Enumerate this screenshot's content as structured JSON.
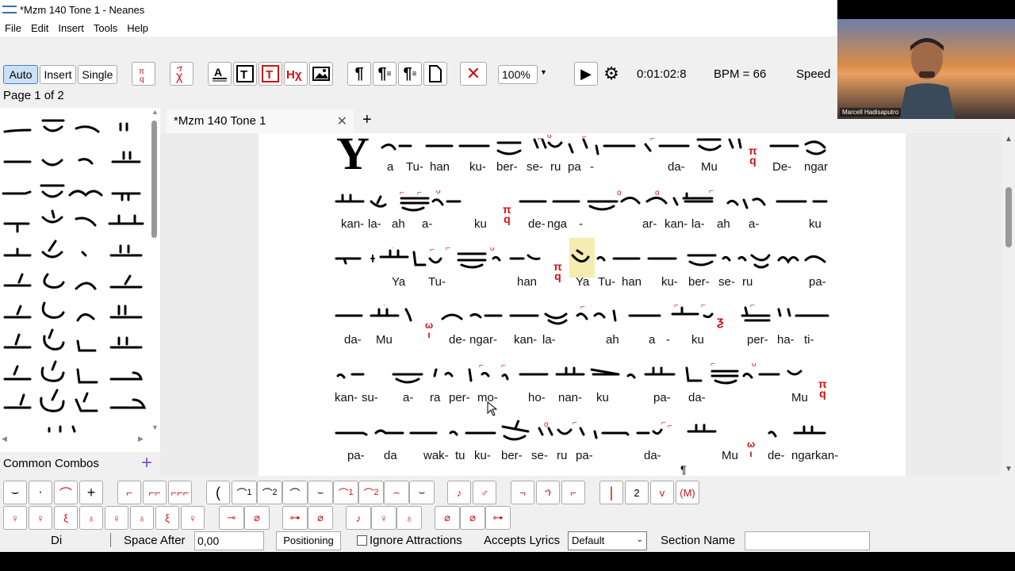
{
  "window": {
    "title": "*Mzm 140 Tone 1 - Neanes"
  },
  "menu": {
    "file": "File",
    "edit": "Edit",
    "insert": "Insert",
    "tools": "Tools",
    "help": "Help"
  },
  "toolbar": {
    "auto": "Auto",
    "insert": "Insert",
    "single": "Single",
    "zoom": "100%",
    "time": "0:01:02:8",
    "bpm": "BPM = 66",
    "speed": "Speed"
  },
  "page_info": "Page 1 of 2",
  "tab": {
    "label": "*Mzm 140 Tone 1"
  },
  "common_combos": "Common Combos",
  "lyrics": {
    "r1": [
      "a",
      "Tu-",
      "han",
      "ku-",
      "ber-",
      "se-",
      "ru",
      "pa",
      "-",
      "da-",
      "Mu",
      "De-",
      "ngar"
    ],
    "r2": [
      "kan-",
      "la-",
      "ah",
      "a-",
      "ku",
      "de-",
      "nga",
      "-",
      "ar-",
      "kan-",
      "la-",
      "ah",
      "a-",
      "ku"
    ],
    "r3": [
      "Ya",
      "Tu-",
      "han",
      "Ya",
      "Tu-",
      "han",
      "ku-",
      "ber-",
      "se-",
      "ru",
      "pa-"
    ],
    "r4": [
      "da-",
      "Mu",
      "de-",
      "ngar-",
      "kan-",
      "la-",
      "ah",
      "a",
      "-",
      "ku",
      "per-",
      "ha-",
      "ti-"
    ],
    "r5": [
      "kan-",
      "su-",
      "a-",
      "ra",
      "per-",
      "mo-",
      "ho-",
      "nan-",
      "ku",
      "pa-",
      "da-",
      "Mu"
    ],
    "r6": [
      "pa-",
      "da",
      "wak-",
      "tu",
      "ku-",
      "ber-",
      "se-",
      "ru",
      "pa-",
      "da-",
      "Mu",
      "de-",
      "ngarkan-"
    ]
  },
  "bottom": {
    "di": "Di",
    "space_after_label": "Space After",
    "space_after_value": "0,00",
    "positioning": "Positioning",
    "ignore_attractions": "Ignore Attractions",
    "accepts_lyrics": "Accepts Lyrics",
    "accepts_lyrics_value": "Default",
    "section_name": "Section Name",
    "btn_two": "2",
    "btn_m": "(M)"
  },
  "video": {
    "name": "Marcell Hadisaputro"
  }
}
